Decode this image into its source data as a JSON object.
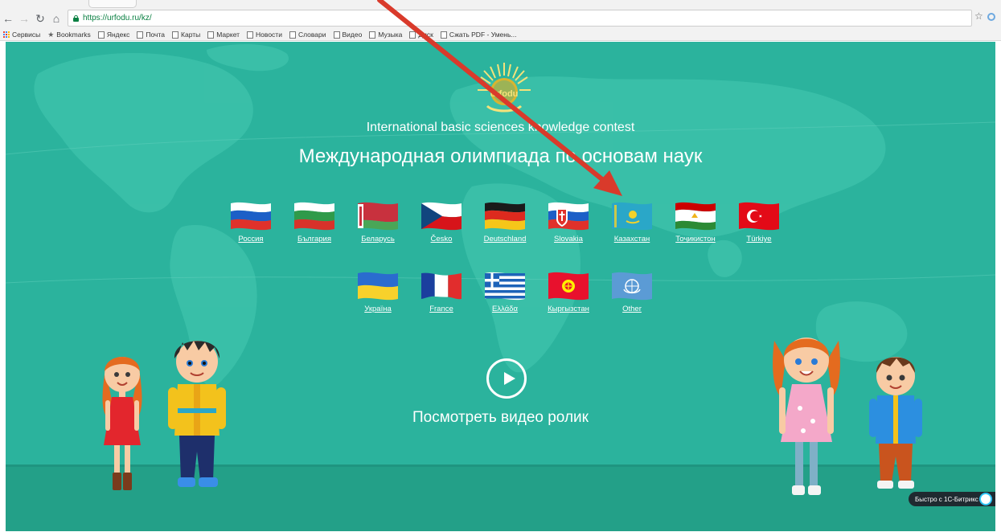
{
  "browser": {
    "url": "https://urfodu.ru/kz/",
    "bookmarks": [
      "Сервисы",
      "Bookmarks",
      "Яндекс",
      "Почта",
      "Карты",
      "Маркет",
      "Новости",
      "Словари",
      "Видео",
      "Музыка",
      "Диск",
      "Сжать PDF - Умень..."
    ]
  },
  "page": {
    "logo_text": "urfodu",
    "subtitle_en": "International basic sciences knowledge contest",
    "title_ru": "Международная олимпиада по основам наук",
    "flags_row1": [
      {
        "label": "Россия",
        "icon": "russia-flag-icon"
      },
      {
        "label": "България",
        "icon": "bulgaria-flag-icon"
      },
      {
        "label": "Беларусь",
        "icon": "belarus-flag-icon"
      },
      {
        "label": "Česko",
        "icon": "czech-flag-icon"
      },
      {
        "label": "Deutschland",
        "icon": "germany-flag-icon"
      },
      {
        "label": "Slovakia",
        "icon": "slovakia-flag-icon"
      },
      {
        "label": "Казахстан",
        "icon": "kazakhstan-flag-icon"
      },
      {
        "label": "Тоҷикистон",
        "icon": "tajikistan-flag-icon"
      },
      {
        "label": "Türkiye",
        "icon": "turkey-flag-icon"
      }
    ],
    "flags_row2": [
      {
        "label": "Україна",
        "icon": "ukraine-flag-icon"
      },
      {
        "label": "France",
        "icon": "france-flag-icon"
      },
      {
        "label": "Ελλάδα",
        "icon": "greece-flag-icon"
      },
      {
        "label": "Кыргызстан",
        "icon": "kyrgyzstan-flag-icon"
      },
      {
        "label": "Other",
        "icon": "un-flag-icon"
      }
    ],
    "video_label": "Посмотреть видео ролик",
    "bitrix_badge": "Быстро с 1С-Битрикс"
  },
  "colors": {
    "background": "#2bb39d",
    "floor": "#23a088",
    "annotation_arrow": "#d93a2b"
  }
}
